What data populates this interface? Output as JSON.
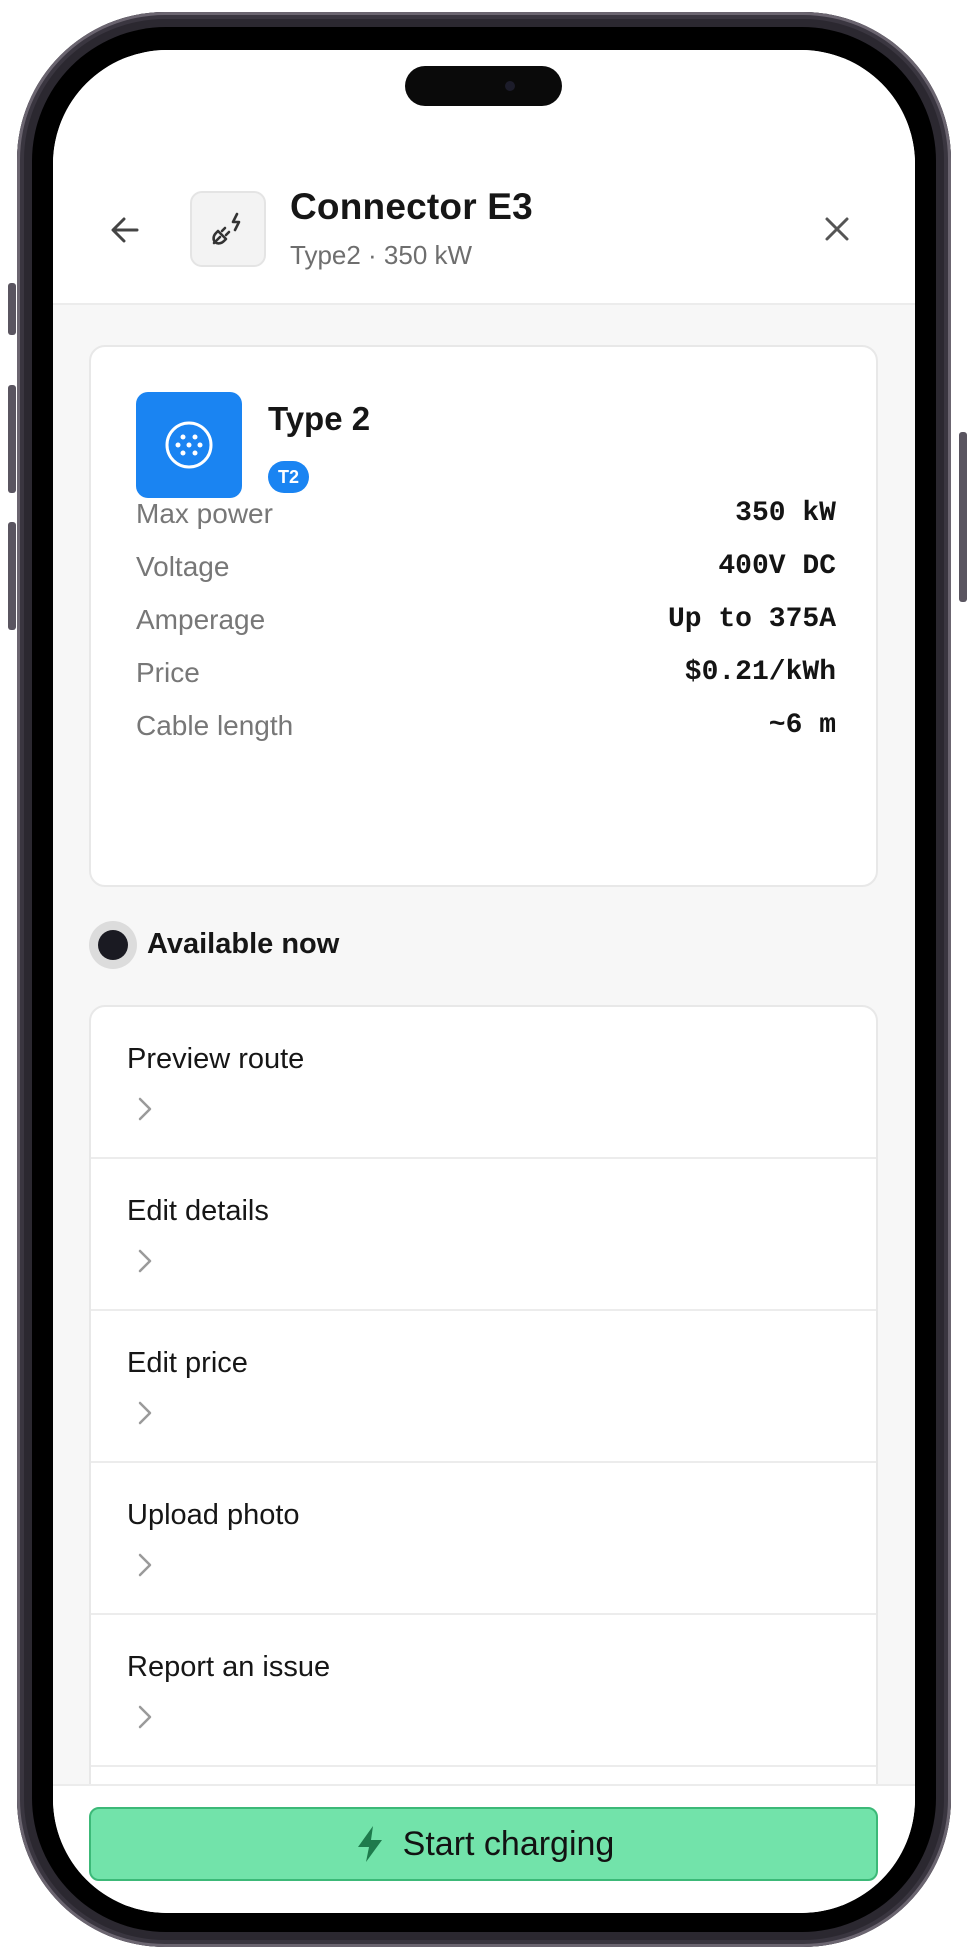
{
  "header": {
    "title": "Connector E3",
    "subtitle": "Type2 · 350 kW"
  },
  "connector": {
    "type_name": "Type 2",
    "badge": "T2",
    "specs": [
      {
        "label": "Max power",
        "value": "350 kW"
      },
      {
        "label": "Voltage",
        "value": "400V DC"
      },
      {
        "label": "Amperage",
        "value": "Up to 375A"
      },
      {
        "label": "Price",
        "value": "$0.21/kWh"
      },
      {
        "label": "Cable length",
        "value": "~6 m"
      }
    ]
  },
  "status": {
    "text": "Available now"
  },
  "actions": [
    {
      "label": "Preview route"
    },
    {
      "label": "Edit details"
    },
    {
      "label": "Edit price"
    },
    {
      "label": "Upload photo"
    },
    {
      "label": "Report an issue"
    }
  ],
  "footer": {
    "start_label": "Start charging"
  },
  "colors": {
    "accent_blue": "#1a84f2",
    "start_button": "#72e3aa",
    "status_dot": "#1a1a22"
  },
  "icons": {
    "back": "arrow-left-icon",
    "header": "plug-icon",
    "close": "close-icon",
    "type": "type2-connector-icon",
    "chevron": "chevron-right-icon",
    "start": "lightning-bolt-icon"
  }
}
